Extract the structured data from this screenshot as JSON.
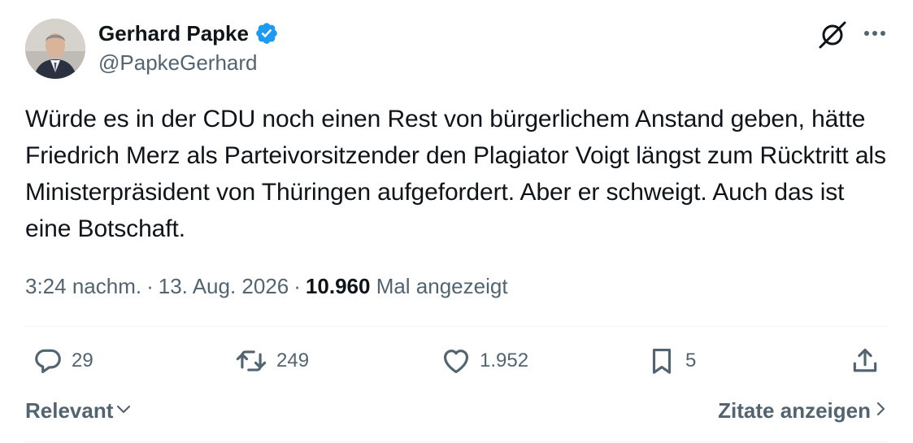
{
  "author": {
    "name": "Gerhard Papke",
    "handle": "@PapkeGerhard",
    "verified_color": "#1d9bf0"
  },
  "icons": {
    "verified": "verified-badge-icon",
    "grok": "grok-icon",
    "more": "more-options-icon",
    "reply": "reply-icon",
    "retweet": "retweet-icon",
    "like": "heart-icon",
    "bookmark": "bookmark-icon",
    "share": "share-icon"
  },
  "tweet": {
    "text": "Würde es in der CDU noch einen Rest von bürgerlichem Anstand geben, hätte Friedrich Merz als Parteivorsitzender den Plagiator Voigt längst zum Rücktritt als Ministerpräsident von Thüringen aufgefordert. Aber er schweigt. Auch das ist eine Botschaft.",
    "time": "3:24 nachm.",
    "date": "13. Aug. 2026",
    "views": "10.960",
    "views_label": "Mal angezeigt"
  },
  "actions": {
    "replies": "29",
    "reposts": "249",
    "likes": "1.952",
    "bookmarks": "5"
  },
  "footer": {
    "sort_label": "Relevant",
    "quotes_label": "Zitate anzeigen"
  }
}
